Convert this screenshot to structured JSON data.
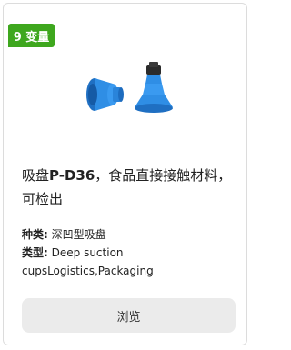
{
  "badge": {
    "text": "9 变量",
    "color": "#3ea71e"
  },
  "product": {
    "title_prefix": "吸盘",
    "title_model": "P-D36",
    "title_suffix": "，食品直接接触材料，可检出",
    "image_icon": "suction-cup-icon",
    "image_color": "#2f8ee5"
  },
  "specs": [
    {
      "key": "种类:",
      "value": "深凹型吸盘"
    },
    {
      "key": "类型:",
      "value": "Deep suction cupsLogistics,Packaging"
    }
  ],
  "actions": {
    "browse_label": "浏览"
  }
}
